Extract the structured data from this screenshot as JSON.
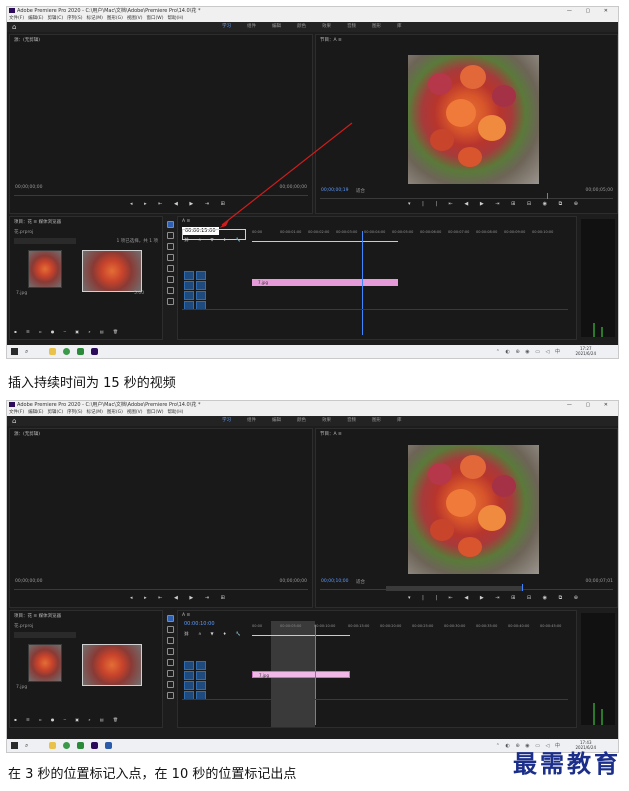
{
  "app": {
    "title": "Adobe Premiere Pro 2020 - C:\\用户\\Mac\\文档\\Adobe\\Premiere Pro\\14.0\\花 *",
    "menu": [
      "文件(F)",
      "编辑(E)",
      "剪辑(C)",
      "序列(S)",
      "标记(M)",
      "图形(G)",
      "视图(V)",
      "窗口(W)",
      "帮助(H)"
    ],
    "workspaces": [
      "学习",
      "组件",
      "编辑",
      "颜色",
      "效果",
      "音频",
      "图形",
      "库"
    ],
    "source_label": "源：(无剪辑)",
    "program_label": "节目：A ≡",
    "project_tabs": "项目：花 ≡  媒体浏览器",
    "project_file": "花.prproj",
    "project_meta": "1 项已选择，共 1 项",
    "sequence_tab": "A ≡",
    "clip_label": "7.jpg",
    "clip_duration": "5:00",
    "fit_label": "适合",
    "colors": {
      "accent": "#3f86ff",
      "clip": "#e59bd8",
      "yellow_bar": "#e7d83a"
    }
  },
  "screens": [
    {
      "source_tc_left": "00;00;00;00",
      "source_tc_right": "00;00;00;00",
      "program_tc": "00;00;00;19",
      "program_tc_right": "00;00;05;00",
      "seq_tc": "00:00:15:00",
      "ruler": [
        "00:00",
        "00:00:01:00",
        "00:00:02:00",
        "00:00:03:00",
        "00:00:04:00",
        "00:00:05:00",
        "00:00:06:00",
        "00:00:07:00",
        "00:00:08:00",
        "00:00:09:00",
        "00:00:10:00"
      ],
      "clock_time": "17:27",
      "clock_date": "2021/6/24"
    },
    {
      "source_tc_left": "00;00;00;00",
      "source_tc_right": "00;00;00;00",
      "program_tc": "00;00;10;00",
      "program_tc_right": "00;00;07;01",
      "seq_tc": "00:00:10:00",
      "ruler": [
        "00:00",
        "00:00:05:00",
        "00:00:10:00",
        "00:00:15:00",
        "00:00:20:00",
        "00:00:25:00",
        "00:00:30:00",
        "00:00:35:00",
        "00:00:40:00",
        "00:00:45:00"
      ],
      "clock_time": "17:43",
      "clock_date": "2021/6/24"
    }
  ],
  "captions": {
    "first": "插入持续时间为 15 秒的视频",
    "second": "在 3 秒的位置标记入点，在 10 秒的位置标记出点"
  },
  "brand": "最需教育"
}
